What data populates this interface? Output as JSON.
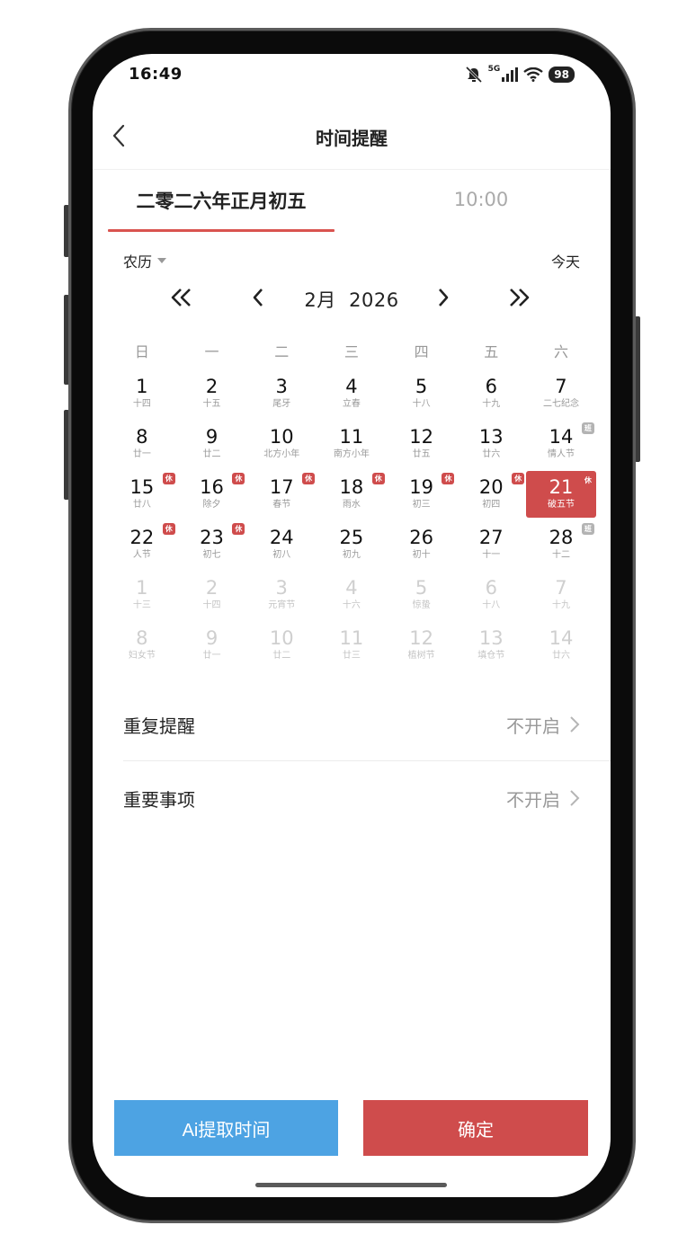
{
  "status": {
    "time": "16:49",
    "signal": "5G",
    "battery": "98"
  },
  "header": {
    "title": "时间提醒"
  },
  "tabs": {
    "date": "二零二六年正月初五",
    "time": "10:00"
  },
  "toolbar": {
    "calendar_mode": "农历",
    "today": "今天"
  },
  "month_nav": {
    "label": "2月  2026"
  },
  "weekdays": [
    "日",
    "一",
    "二",
    "三",
    "四",
    "五",
    "六"
  ],
  "calendar": {
    "days": [
      {
        "d": "1",
        "sub": "十四"
      },
      {
        "d": "2",
        "sub": "十五"
      },
      {
        "d": "3",
        "sub": "尾牙"
      },
      {
        "d": "4",
        "sub": "立春"
      },
      {
        "d": "5",
        "sub": "十八"
      },
      {
        "d": "6",
        "sub": "十九"
      },
      {
        "d": "7",
        "sub": "二七纪念"
      },
      {
        "d": "8",
        "sub": "廿一"
      },
      {
        "d": "9",
        "sub": "廿二"
      },
      {
        "d": "10",
        "sub": "北方小年"
      },
      {
        "d": "11",
        "sub": "南方小年"
      },
      {
        "d": "12",
        "sub": "廿五"
      },
      {
        "d": "13",
        "sub": "廿六"
      },
      {
        "d": "14",
        "sub": "情人节",
        "badge": "班"
      },
      {
        "d": "15",
        "sub": "廿八",
        "badge": "休"
      },
      {
        "d": "16",
        "sub": "除夕",
        "badge": "休"
      },
      {
        "d": "17",
        "sub": "春节",
        "badge": "休"
      },
      {
        "d": "18",
        "sub": "雨水",
        "badge": "休"
      },
      {
        "d": "19",
        "sub": "初三",
        "badge": "休"
      },
      {
        "d": "20",
        "sub": "初四",
        "badge": "休"
      },
      {
        "d": "21",
        "sub": "破五节",
        "badge": "休",
        "selected": true
      },
      {
        "d": "22",
        "sub": "人节",
        "badge": "休"
      },
      {
        "d": "23",
        "sub": "初七",
        "badge": "休"
      },
      {
        "d": "24",
        "sub": "初八"
      },
      {
        "d": "25",
        "sub": "初九"
      },
      {
        "d": "26",
        "sub": "初十"
      },
      {
        "d": "27",
        "sub": "十一"
      },
      {
        "d": "28",
        "sub": "十二",
        "badge": "班"
      },
      {
        "d": "1",
        "sub": "十三",
        "dim": true
      },
      {
        "d": "2",
        "sub": "十四",
        "dim": true
      },
      {
        "d": "3",
        "sub": "元宵节",
        "dim": true
      },
      {
        "d": "4",
        "sub": "十六",
        "dim": true
      },
      {
        "d": "5",
        "sub": "惊蛰",
        "dim": true
      },
      {
        "d": "6",
        "sub": "十八",
        "dim": true
      },
      {
        "d": "7",
        "sub": "十九",
        "dim": true
      },
      {
        "d": "8",
        "sub": "妇女节",
        "dim": true
      },
      {
        "d": "9",
        "sub": "廿一",
        "dim": true
      },
      {
        "d": "10",
        "sub": "廿二",
        "dim": true
      },
      {
        "d": "11",
        "sub": "廿三",
        "dim": true
      },
      {
        "d": "12",
        "sub": "植树节",
        "dim": true
      },
      {
        "d": "13",
        "sub": "填仓节",
        "dim": true
      },
      {
        "d": "14",
        "sub": "廿六",
        "dim": true
      }
    ]
  },
  "settings": {
    "repeat": {
      "label": "重复提醒",
      "value": "不开启"
    },
    "important": {
      "label": "重要事项",
      "value": "不开启"
    }
  },
  "buttons": {
    "ai": "Ai提取时间",
    "confirm": "确定"
  },
  "colors": {
    "accent": "#cf4c4c",
    "ai_button": "#4da3e3",
    "work_badge": "#b3b3b3"
  }
}
